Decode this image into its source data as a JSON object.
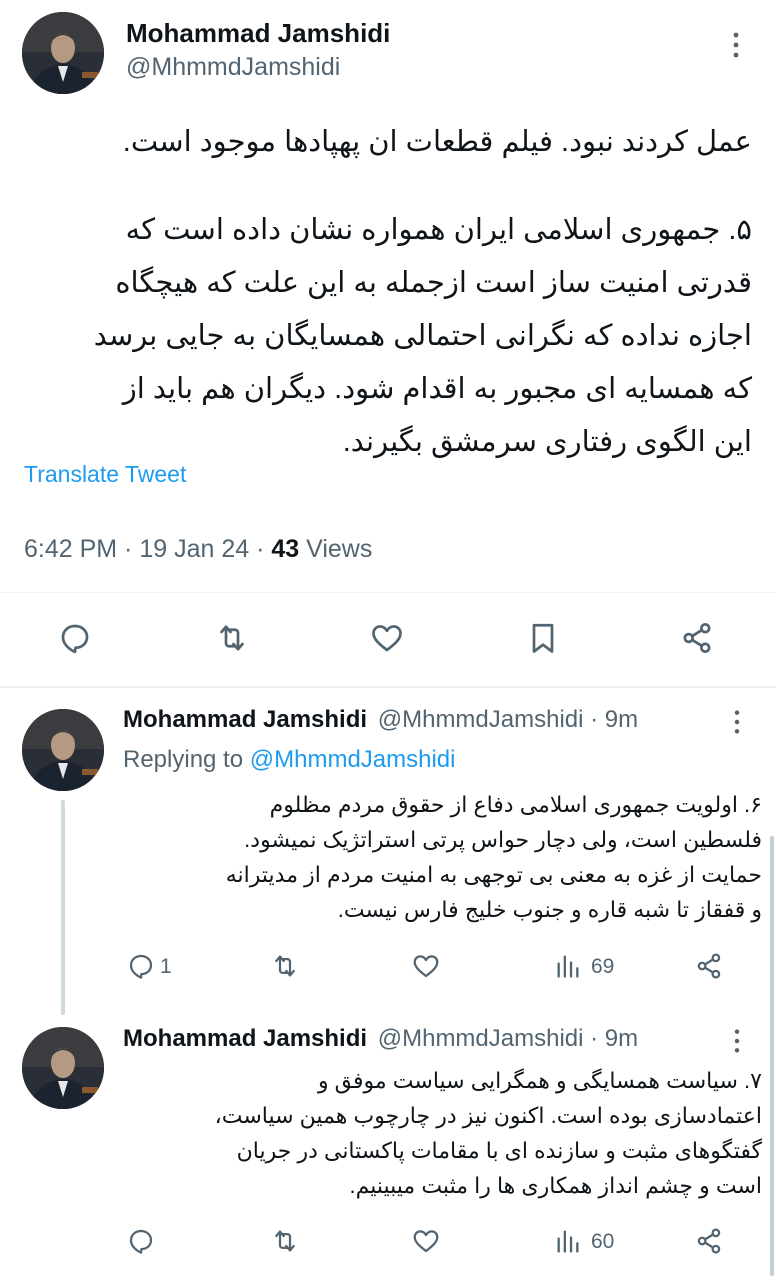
{
  "main_tweet": {
    "author_name": "Mohammad Jamshidi",
    "handle": "@MhmmdJamshidi",
    "text_lines": [
      "عمل کردند نبود. فیلم قطعات ان پهپادها موجود است.",
      "۵. جمهوری اسلامی ایران همواره نشان داده است که",
      "قدرتی امنیت ساز است ازجمله به این علت که هیچگاه",
      "اجازه نداده که نگرانی احتمالی همسایگان به جایی برسد",
      "که همسایه ای مجبور به اقدام شود. دیگران هم باید از",
      "این الگوی رفتاری سرمشق بگیرند."
    ],
    "translate_label": "Translate Tweet",
    "timestamp": "6:42 PM · 19 Jan 24 · ",
    "views_count": "43",
    "views_label": " Views"
  },
  "replies": [
    {
      "author_name": "Mohammad Jamshidi",
      "handle_time": "@MhmmdJamshidi · 9m",
      "replying_to_label": "Replying to ",
      "replying_to_handle": "@MhmmdJamshidi",
      "text_lines": [
        "۶. اولویت جمهوری اسلامی دفاع از حقوق مردم مظلوم",
        "فلسطین است، ولی دچار حواس پرتی استراتژیک نمیشود.",
        "حمایت از غزه به معنی بی توجهی به امنیت مردم از مدیترانه",
        "و قفقاز تا شبه قاره و جنوب خلیج فارس نیست."
      ],
      "reply_count": "1",
      "views_count": "69"
    },
    {
      "author_name": "Mohammad Jamshidi",
      "handle_time": "@MhmmdJamshidi · 9m",
      "text_lines": [
        "۷. سیاست همسایگی و همگرایی سیاست موفق و",
        "اعتمادسازی بوده است. اکنون نیز در چارچوب همین سیاست،",
        "گفتگوهای مثبت و سازنده ای با مقامات پاکستانی در جریان",
        "است و چشم انداز همکاری ها را مثبت میبینیم."
      ],
      "views_count": "60"
    }
  ],
  "icons": {
    "more": "more-dots-icon",
    "reply": "reply-bubble-icon",
    "retweet": "retweet-icon",
    "like": "heart-icon",
    "bookmark": "bookmark-icon",
    "share": "share-icon",
    "views": "bar-chart-icon"
  },
  "colors": {
    "text": "#0f1419",
    "muted": "#536471",
    "accent": "#1d9bf0",
    "divider": "#eff3f4",
    "thread_line": "#cfd9de"
  }
}
